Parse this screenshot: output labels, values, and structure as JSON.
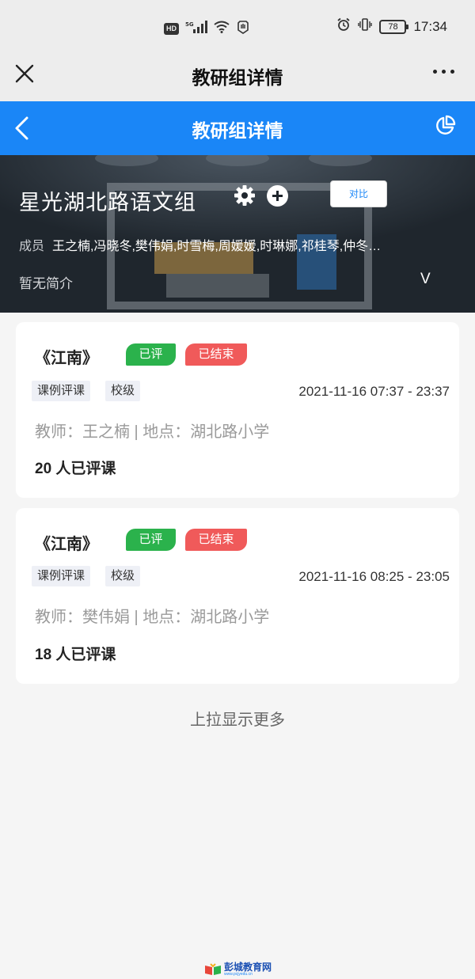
{
  "status_bar": {
    "hd": "HD",
    "net": "5G",
    "battery": "78",
    "time": "17:34"
  },
  "wechat_bar": {
    "title": "教研组详情"
  },
  "app_bar": {
    "title": "教研组详情"
  },
  "group": {
    "name": "星光湖北路语文组",
    "compare_label": "对比",
    "members_label": "成员",
    "members": "王之楠,冯晓冬,樊伟娟,时雪梅,周媛媛,时琳娜,祁桂琴,仲冬…",
    "intro": "暂无简介",
    "expand": "V"
  },
  "cards": [
    {
      "title": "《江南》",
      "badge_rated": "已评",
      "badge_ended": "已结束",
      "tag_type": "课例评课",
      "tag_level": "校级",
      "time": "2021-11-16 07:37 - 23:37",
      "teacher": "教师：王之楠 | 地点：湖北路小学",
      "count": "20 人已评课"
    },
    {
      "title": "《江南》",
      "badge_rated": "已评",
      "badge_ended": "已结束",
      "tag_type": "课例评课",
      "tag_level": "校级",
      "time": "2021-11-16 08:25 - 23:05",
      "teacher": "教师：樊伟娟 | 地点：湖北路小学",
      "count": "18 人已评课"
    }
  ],
  "load_more": "上拉显示更多",
  "watermark": {
    "name": "彭城教育网",
    "url": "www.pcjyedu.cn"
  },
  "colors": {
    "primary": "#1a86f7",
    "green": "#2bb24c",
    "red": "#f05a5a",
    "hero": "#1f262d"
  }
}
